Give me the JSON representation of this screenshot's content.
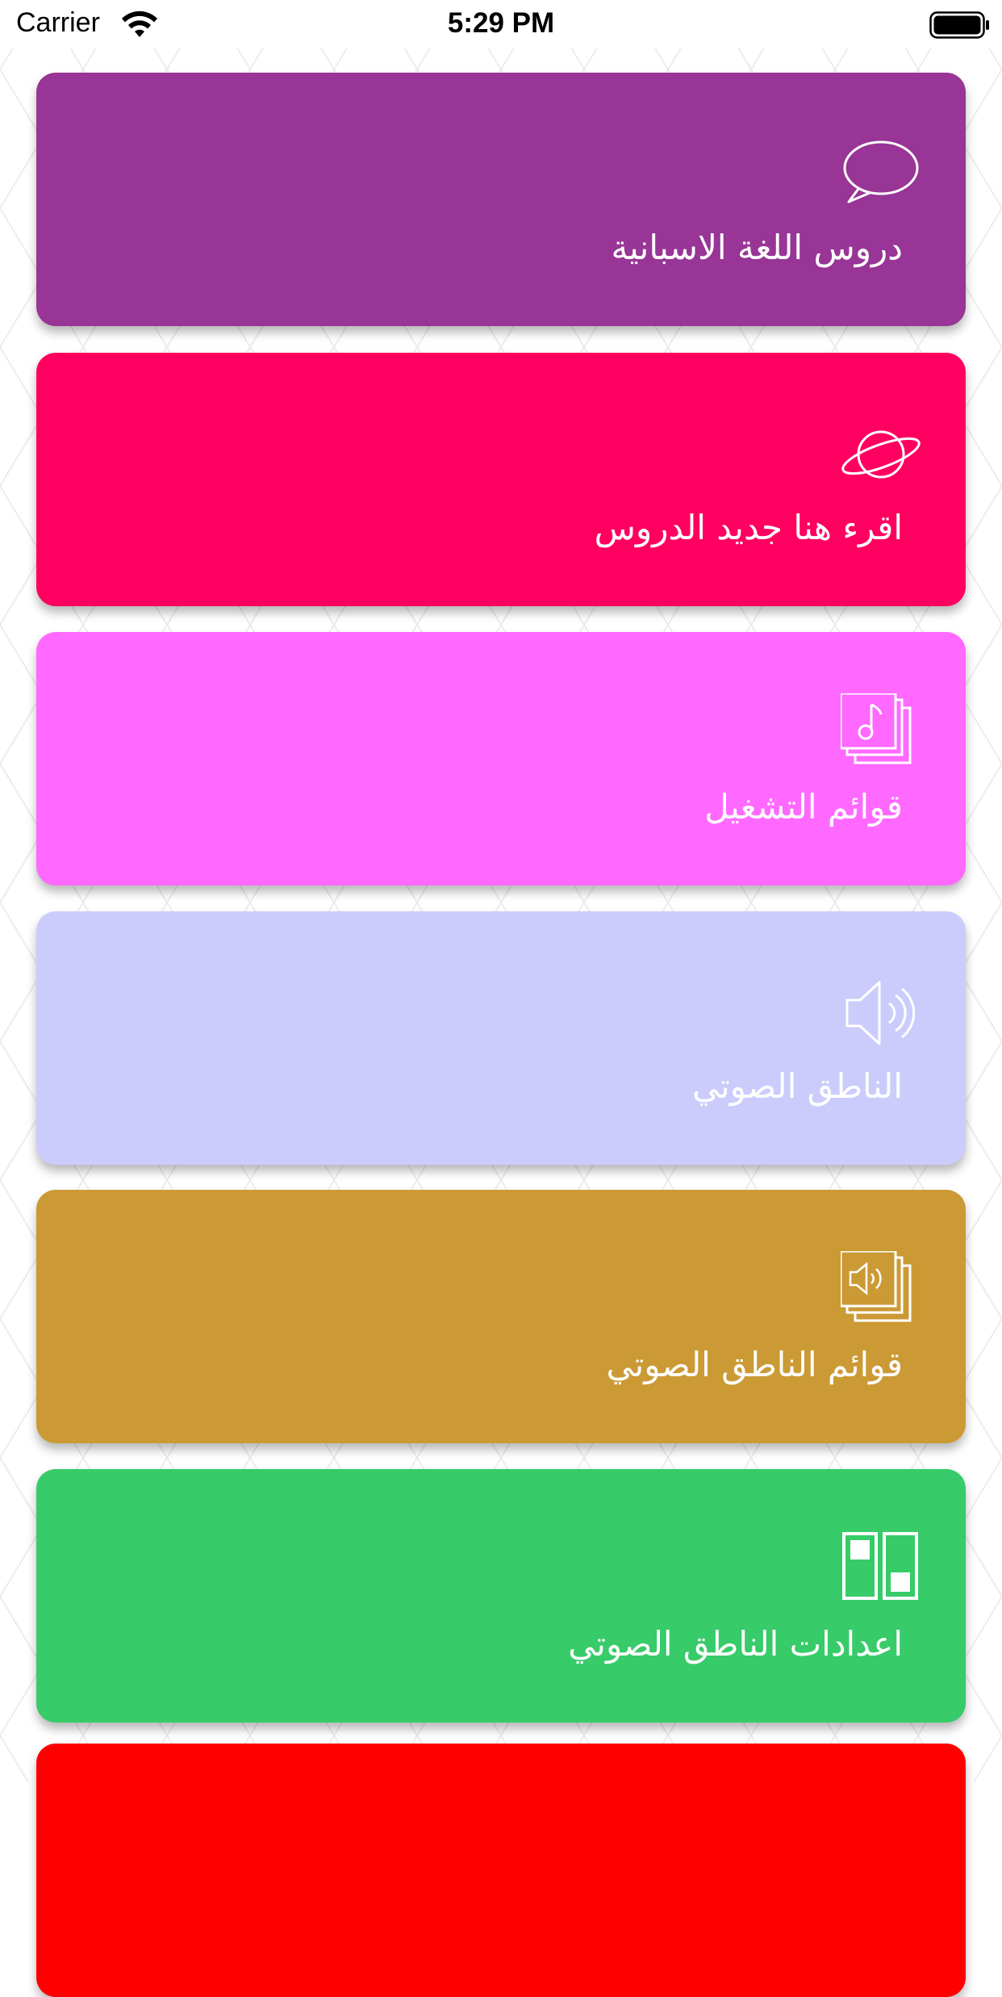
{
  "status_bar": {
    "carrier": "Carrier",
    "time": "5:29 PM"
  },
  "cards": [
    {
      "label": "دروس اللغة الاسبانية",
      "icon": "speech-bubble-icon",
      "color": "#983596"
    },
    {
      "label": "اقرء هنا جديد الدروس",
      "icon": "planet-icon",
      "color": "#FF0060"
    },
    {
      "label": "قوائم التشغيل",
      "icon": "music-playlist-icon",
      "color": "#FF69FF"
    },
    {
      "label": "الناطق الصوتي",
      "icon": "speaker-icon",
      "color": "#CCCCFC"
    },
    {
      "label": "قوائم الناطق الصوتي",
      "icon": "speaker-playlist-icon",
      "color": "#CB9A34"
    },
    {
      "label": "اعدادات الناطق الصوتي",
      "icon": "settings-switches-icon",
      "color": "#37CB69"
    },
    {
      "label": "",
      "icon": "",
      "color": "#FF0000"
    }
  ]
}
